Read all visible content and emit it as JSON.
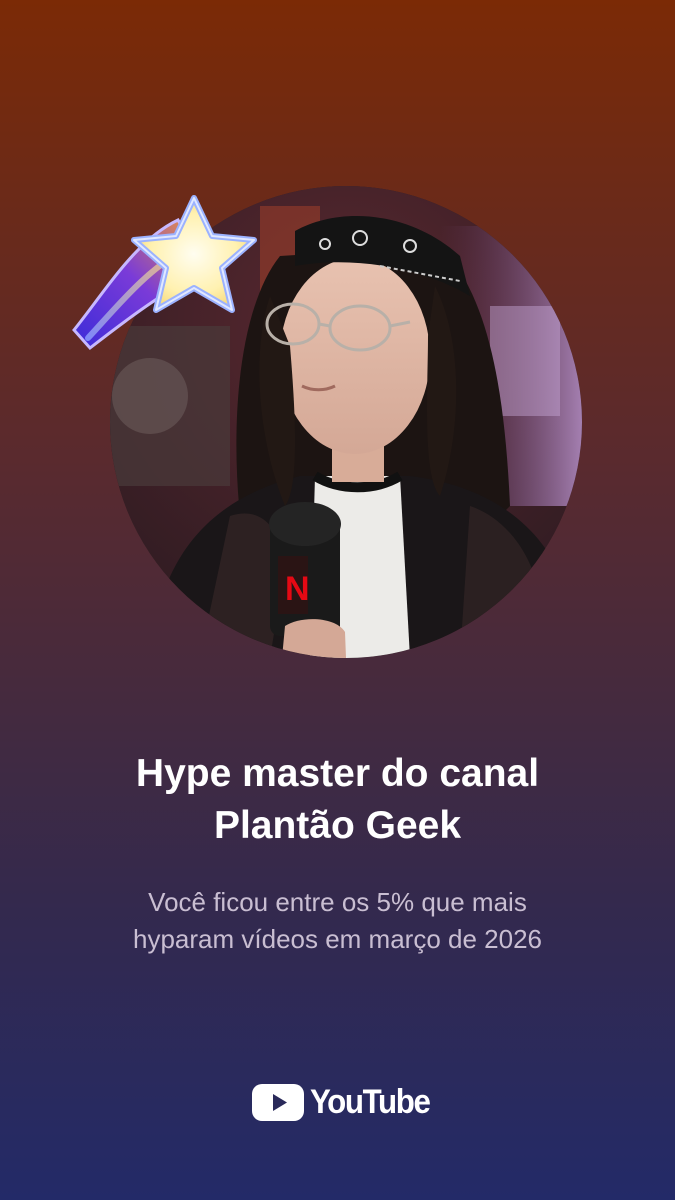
{
  "card": {
    "title_line1": "Hype master do canal",
    "title_line2": "Plantão Geek",
    "subtitle_line1": "Você ficou entre os 5% que mais",
    "subtitle_line2": "hyparam vídeos em março de 2026"
  },
  "avatar": {
    "icon": "profile-photo",
    "mic_flag_letter": "N"
  },
  "badge": {
    "icon": "shooting-star-icon"
  },
  "brand": {
    "icon": "youtube-play-icon",
    "wordmark": "YouTube"
  },
  "colors": {
    "background_top": "#7b2a06",
    "background_bottom": "#232a68",
    "title": "#ffffff",
    "subtitle": "#c9bed2",
    "youtube_play": "#ffffff"
  }
}
